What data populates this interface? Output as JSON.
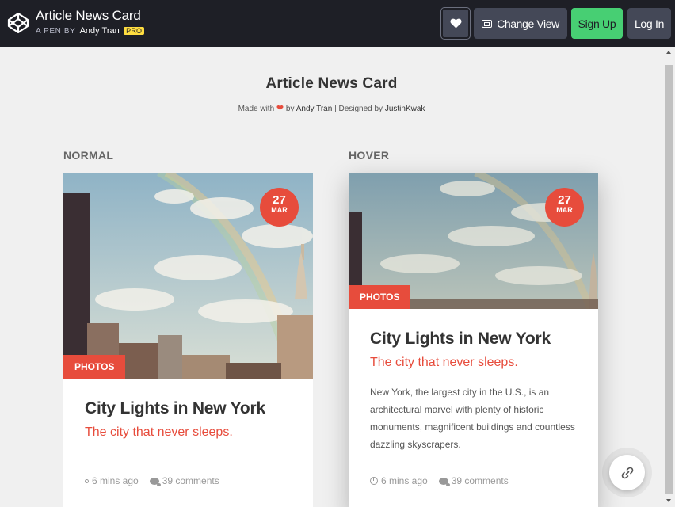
{
  "topbar": {
    "title": "Article News Card",
    "meta_prefix": "A PEN BY",
    "author": "Andy Tran",
    "badge": "PRO",
    "change_view_label": "Change View",
    "signup_label": "Sign Up",
    "login_label": "Log In"
  },
  "page": {
    "title": "Article News Card",
    "credits": {
      "made_with": "Made with",
      "by": "by",
      "author": "Andy Tran",
      "designed_by": "| Designed by",
      "designer": "JustinKwak"
    },
    "normal_label": "NORMAL",
    "hover_label": "HOVER"
  },
  "cards": [
    {
      "state": "normal",
      "day": "27",
      "month": "MAR",
      "category": "PHOTOS",
      "title": "City Lights in New York",
      "subtitle": "The city that never sleeps.",
      "time": "6 mins ago",
      "comments": "39 comments"
    },
    {
      "state": "hover",
      "day": "27",
      "month": "MAR",
      "category": "PHOTOS",
      "title": "City Lights in New York",
      "subtitle": "The city that never sleeps.",
      "description": "New York, the largest city in the U.S., is an architectural marvel with plenty of historic monuments, magnificent buildings and countless dazzling skyscrapers.",
      "time": "6 mins ago",
      "comments": "39 comments"
    }
  ],
  "colors": {
    "accent": "#e74c3c",
    "topbar": "#1e1f26",
    "signup": "#47cf73",
    "pro_badge": "#ffdd40"
  },
  "icons": [
    "codepen-logo-icon",
    "heart-icon",
    "change-view-icon",
    "clock-icon",
    "comment-icon",
    "link-icon"
  ]
}
